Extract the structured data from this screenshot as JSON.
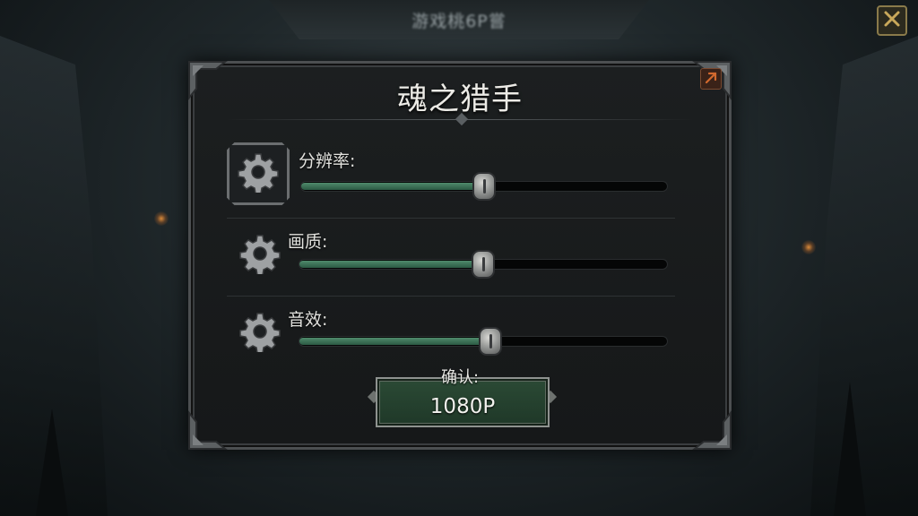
{
  "top_banner": {
    "text": "游戏桃6P嘗"
  },
  "dialog": {
    "title": "魂之猎手",
    "settings": [
      {
        "label": "分辨率:",
        "icon": "gear-icon",
        "value": 0.5
      },
      {
        "label": "画质:",
        "icon": "gear-icon",
        "value": 0.5
      },
      {
        "label": "音效:",
        "icon": "gear-icon",
        "value": 0.52
      }
    ],
    "confirm": {
      "label": "确认:",
      "value": "1080P"
    }
  },
  "colors": {
    "panel_bg": "#1a1d1e",
    "slider_fill": "#3d7256",
    "button_bg": "#274430",
    "close_accent": "#d2692e",
    "gold_x": "#c9a85a"
  }
}
